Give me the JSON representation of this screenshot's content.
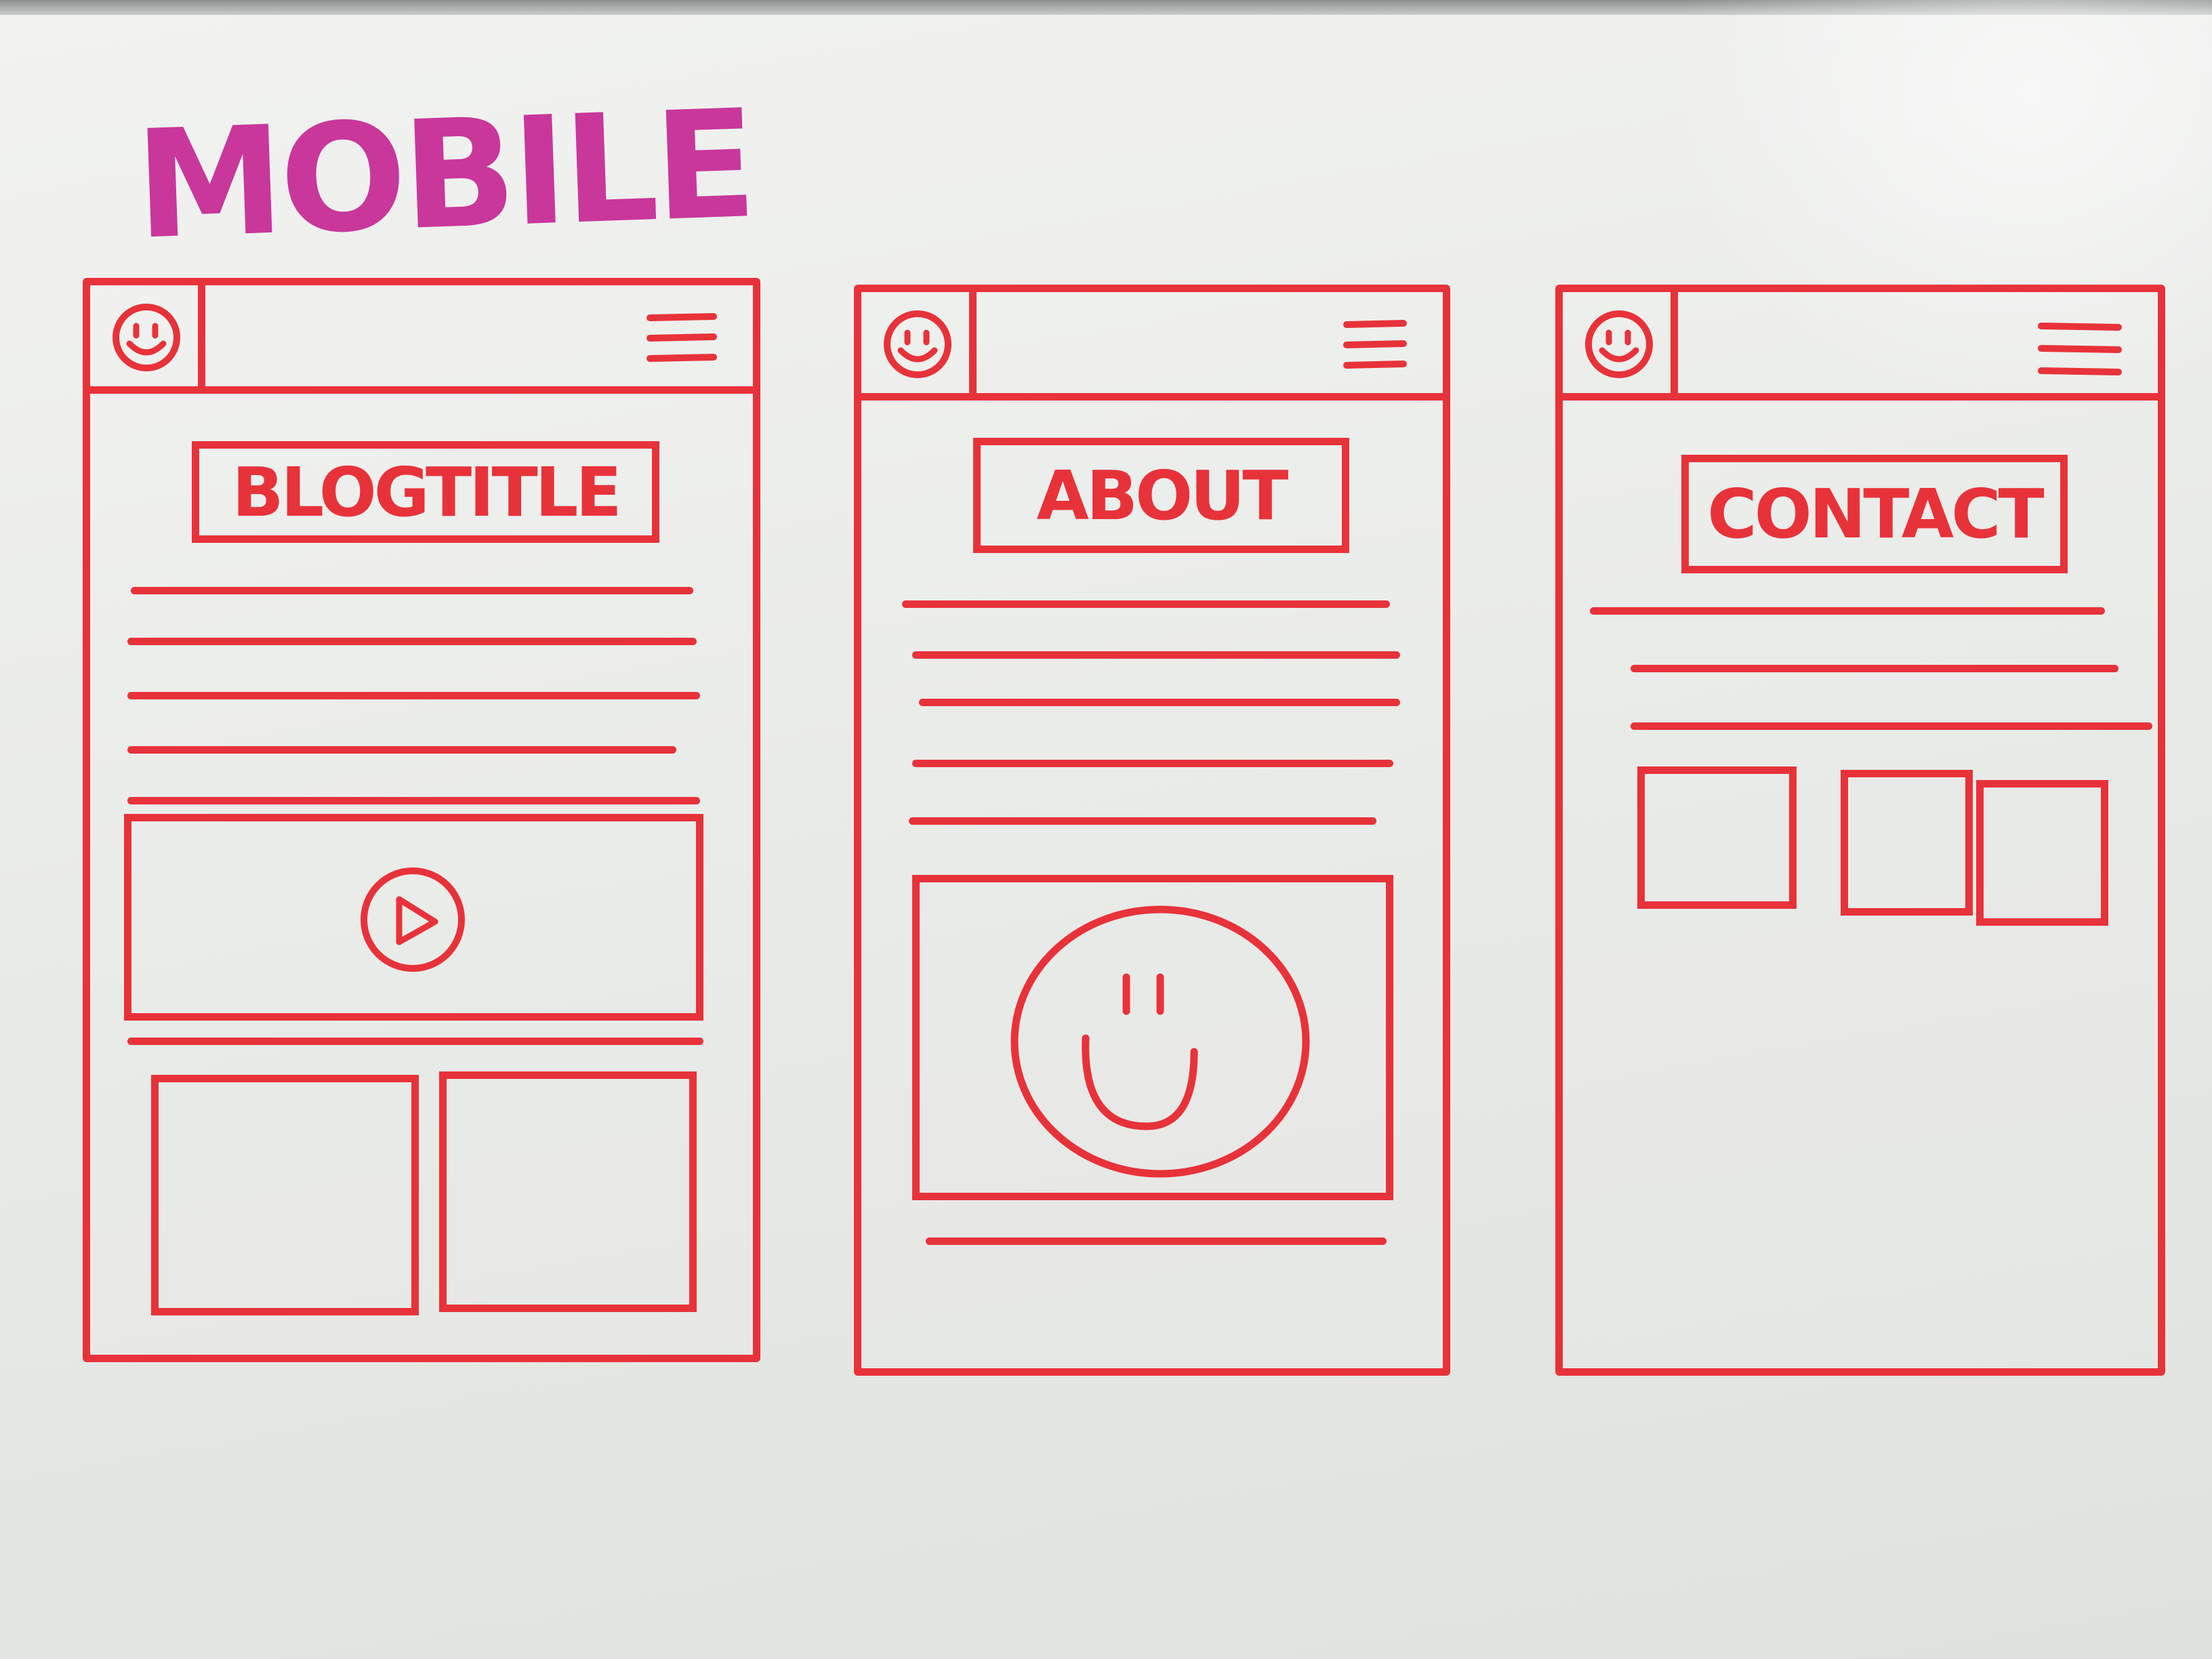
{
  "heading": "MOBILE",
  "colors": {
    "marker_red": "#e8323a",
    "marker_magenta": "#c9379b"
  },
  "screens": [
    {
      "title": "BLOGTITLE",
      "logo_icon": "smiley-icon",
      "menu_icon": "hamburger-menu-icon",
      "content": [
        "text-lines",
        "video-player",
        "two-image-tiles"
      ],
      "media_icon": "play-icon"
    },
    {
      "title": "ABOUT",
      "logo_icon": "smiley-icon",
      "menu_icon": "hamburger-menu-icon",
      "content": [
        "text-lines",
        "profile-image"
      ],
      "media_icon": "smiley-icon"
    },
    {
      "title": "CONTACT",
      "logo_icon": "smiley-icon",
      "menu_icon": "hamburger-menu-icon",
      "content": [
        "text-lines",
        "three-image-tiles"
      ]
    }
  ]
}
